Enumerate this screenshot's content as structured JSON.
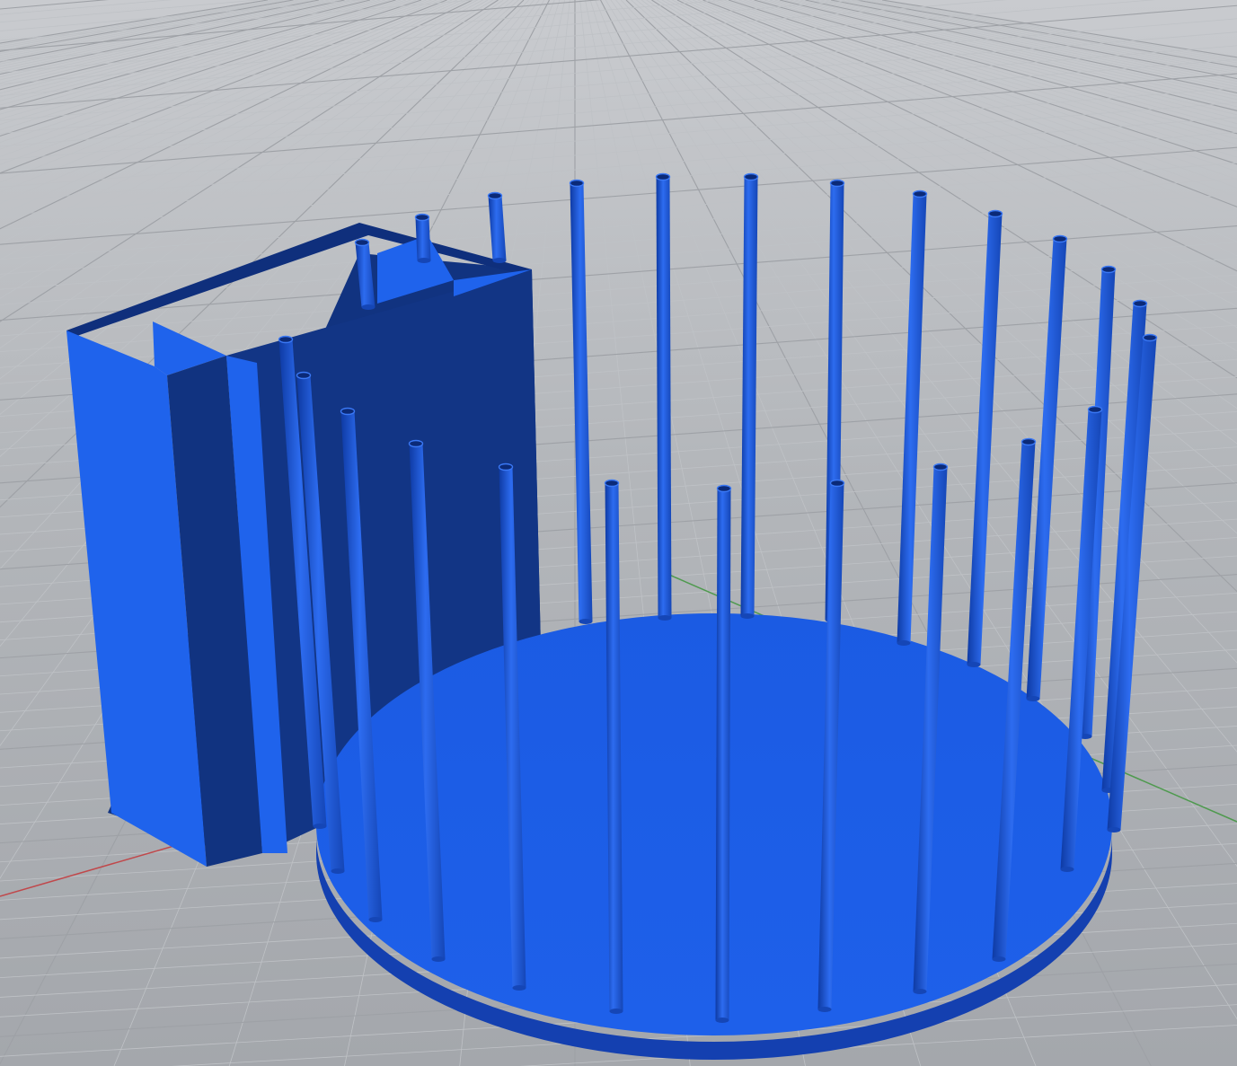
{
  "viewport": {
    "view": "perspective",
    "grid_visible": true,
    "axes": {
      "x_axis_color": "#c0484b",
      "y_axis_color": "#4f9a4f"
    }
  },
  "colors": {
    "background_top": "#c9cbcf",
    "background_bottom": "#a4a7ac",
    "grid_minor": "#bfc2c6",
    "grid_major": "#9ea1a6",
    "object_light": "#1f63ec",
    "object_mid": "#1a55d8",
    "object_dark": "#113380",
    "object_edge": "#0b2a78"
  },
  "scene_objects": {
    "base_disc": "circular-base-plate",
    "rods": "vertical-rods",
    "block": "rectangular-block-with-slots"
  }
}
